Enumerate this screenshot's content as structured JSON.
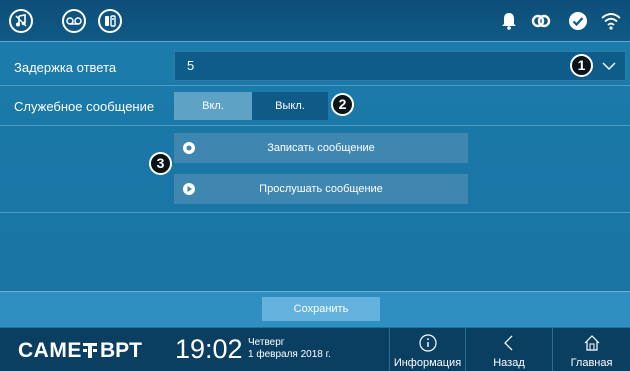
{
  "topbar": {
    "left_icons": [
      "music-note-icon",
      "voicemail-icon",
      "intercom-icon"
    ],
    "status_icons": [
      "bell-icon",
      "link-icon",
      "check-circle-icon",
      "wifi-icon"
    ]
  },
  "answer_delay": {
    "label": "Задержка ответа",
    "value": "5",
    "callout": "1"
  },
  "service_message": {
    "label": "Служебное сообщение",
    "on_label": "Вкл.",
    "off_label": "Выкл.",
    "selected": "Вкл.",
    "callout": "2"
  },
  "actions": {
    "callout": "3",
    "record_label": "Записать сообщение",
    "play_label": "Прослушать сообщение"
  },
  "save_label": "Сохранить",
  "bottombar": {
    "brand": "CAME",
    "brand2": "BPT",
    "time": "19:02",
    "day": "Четверг",
    "date": "1 февраля 2018 г.",
    "nav": {
      "info": "Информация",
      "back": "Назад",
      "home": "Главная"
    }
  },
  "colors": {
    "background": "#1a77a6",
    "topbar": "#0d4e78",
    "bottombar": "#0b3f62",
    "button": "#3f87b0",
    "save_button": "#63b2dd"
  }
}
